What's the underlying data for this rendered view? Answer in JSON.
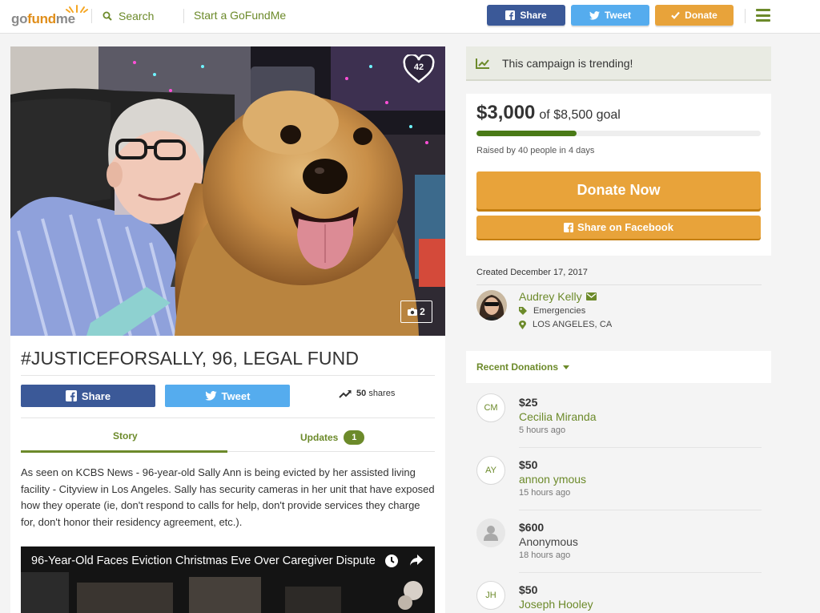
{
  "nav": {
    "logo": {
      "go": "go",
      "fund": "fund",
      "me": "me"
    },
    "search_label": "Search",
    "start_label": "Start a GoFundMe",
    "share_label": "Share",
    "tweet_label": "Tweet",
    "donate_label": "Donate"
  },
  "campaign": {
    "heart_count": "42",
    "photo_count": "2",
    "title": "#JUSTICEFORSALLY, 96, LEGAL FUND",
    "share_label": "Share",
    "tweet_label": "Tweet",
    "shares_count": "50",
    "shares_word": "shares",
    "tabs": {
      "story": "Story",
      "updates": "Updates",
      "updates_count": "1"
    },
    "story": "As seen on KCBS News - 96-year-old Sally Ann is being evicted by her assisted living facility - Cityview in Los Angeles. Sally has security cameras in her unit that have exposed how they operate (ie, don't respond to calls for help, don't provide services they charge for, don't honor their residency agreement, etc.).",
    "video_title": "96-Year-Old Faces Eviction Christmas Eve Over Caregiver Dispute"
  },
  "sidebar": {
    "trending_text": "This campaign is trending!",
    "raised_amount": "$3,000",
    "goal_text": "of $8,500 goal",
    "progress_fraction": 0.353,
    "raised_by": "Raised by 40 people in 4 days",
    "donate_now": "Donate Now",
    "share_facebook": "Share on Facebook",
    "created": "Created December 17, 2017",
    "organizer": {
      "name": "Audrey Kelly",
      "category": "Emergencies",
      "location": "LOS ANGELES, CA"
    },
    "recent_label": "Recent Donations",
    "donations": [
      {
        "initials": "CM",
        "amount": "$25",
        "name": "Cecilia Miranda",
        "time": "5 hours ago"
      },
      {
        "initials": "AY",
        "amount": "$50",
        "name": "annon ymous",
        "time": "15 hours ago"
      },
      {
        "initials": "",
        "amount": "$600",
        "name": "Anonymous",
        "time": "18 hours ago"
      },
      {
        "initials": "JH",
        "amount": "$50",
        "name": "Joseph Hooley",
        "time": ""
      }
    ]
  },
  "colors": {
    "brand_green": "#6c8a2a",
    "donate_orange": "#e8a33a",
    "facebook": "#3b5998",
    "twitter": "#55acee"
  },
  "icons": [
    "search-icon",
    "facebook-icon",
    "twitter-icon",
    "checkmark-icon",
    "menu-icon",
    "heart-icon",
    "camera-icon",
    "trending-icon",
    "envelope-icon",
    "tag-icon",
    "location-pin-icon",
    "caret-down-icon",
    "clock-icon",
    "share-arrow-icon",
    "anonymous-user-icon"
  ]
}
